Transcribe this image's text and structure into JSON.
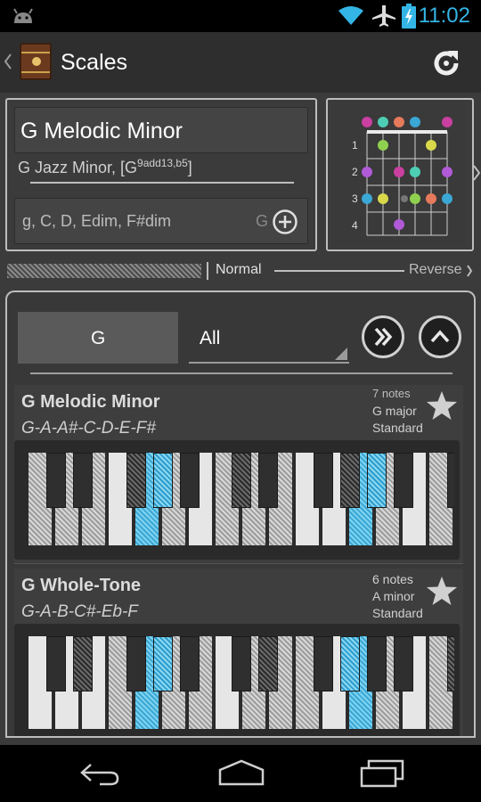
{
  "status_bar": {
    "time": "11:02",
    "icons": [
      "android-icon",
      "wifi-icon",
      "airplane-icon",
      "battery-charging-icon"
    ]
  },
  "action_bar": {
    "title": "Scales",
    "back_icon": "chevron-left-icon",
    "app_icon": "guitar-icon",
    "refresh_icon": "refresh-icon"
  },
  "chord_panel": {
    "scale_name": "G Melodic Minor",
    "chord_prefix": "G Jazz Minor, [G",
    "chord_sup": "9add13,b5",
    "chord_suffix": "]",
    "chord_list": "ɡ, C, D, Edim, F#dim",
    "chord_list_end": "G",
    "add_icon": "plus-circle-icon"
  },
  "fretboard": {
    "fret_numbers": [
      "1",
      "2",
      "3",
      "4"
    ]
  },
  "mode_toggle": {
    "normal_label": "Normal",
    "reverse_label": "Reverse"
  },
  "filter": {
    "root_value": "G",
    "type_value": "All",
    "next_icon": "fast-forward-icon",
    "collapse_icon": "chevron-up-icon"
  },
  "scales": [
    {
      "name": "G Melodic Minor",
      "notes": "G-A-A#-C-D-E-F#",
      "count": "7 notes",
      "relative": "G major",
      "tuning": "Standard",
      "favorite_icon": "star-icon"
    },
    {
      "name": "G Whole-Tone",
      "notes": "G-A-B-C#-Eb-F",
      "count": "6 notes",
      "relative": "A minor",
      "tuning": "Standard",
      "favorite_icon": "star-icon"
    }
  ],
  "nav_bar": {
    "back_icon": "back-icon",
    "home_icon": "home-icon",
    "recents_icon": "recents-icon"
  },
  "colors": {
    "accent": "#33b5e5",
    "highlight_blue": "#3aa7d4",
    "note_green": "#8fd14f",
    "note_pink": "#c940a0",
    "note_teal": "#4ecdb5",
    "note_orange": "#e67a5c",
    "note_yellow": "#d8d84a",
    "note_purple": "#b05ad8"
  }
}
